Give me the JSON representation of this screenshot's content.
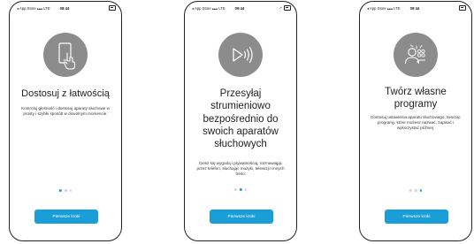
{
  "colors": {
    "accent": "#1a9ed8",
    "icon_circle": "#8c8c8c",
    "dot_inactive": "#d0d3d8",
    "frame": "#222222"
  },
  "screens": [
    {
      "status": {
        "carrier": "◂ App Store ▴▴▴ LTE",
        "time": "08:44",
        "icons": [
          "battery-icon"
        ]
      },
      "icon": "phone-tap-icon",
      "title": "Dostosuj z łatwością",
      "description": "Kontroluj głośność i dostosuj aparaty słuchowe w prosty i szybki sposób w dowolnym momencie.",
      "active_dot": 0,
      "button_label": "Pierwsze kroki"
    },
    {
      "status": {
        "carrier": "◂ App Store ▴▴▴ LTE",
        "time": "09:44",
        "icons": [
          "location-icon",
          "battery-icon"
        ]
      },
      "icon": "streaming-icon",
      "title": "Przesyłaj strumieniowo bezpośrednio do swoich aparatów słuchowych",
      "description": "Ciesz się wygodą i prywatnością, rozmawiając przez telefon, słuchając muzyki, telewizji i innych treści",
      "active_dot": 1,
      "button_label": "Pierwsze kroki"
    },
    {
      "status": {
        "carrier": "◂ App Store ▴▴▴ LTE",
        "time": "09:44",
        "icons": [
          "battery-icon"
        ]
      },
      "icon": "programs-user-icon",
      "title": "Twórz własne programy",
      "description": "Dostosuj ustawienia aparatu słuchowego, tworząc programy, które możesz nazwać, zapisać i wykorzystać później.",
      "active_dot": 2,
      "button_label": "Pierwsze kroki"
    }
  ]
}
